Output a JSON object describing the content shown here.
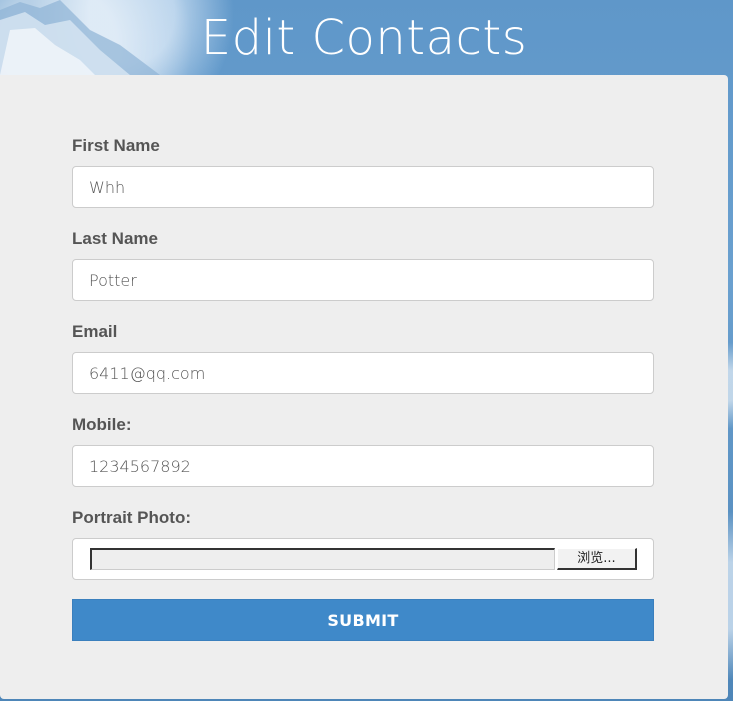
{
  "header": {
    "title": "Edit Contacts"
  },
  "form": {
    "first_name": {
      "label": "First Name",
      "value": "Whh"
    },
    "last_name": {
      "label": "Last Name",
      "value": "Potter"
    },
    "email": {
      "label": "Email",
      "value": "6411@qq.com"
    },
    "mobile": {
      "label": "Mobile:",
      "value": "1234567892"
    },
    "portrait_photo": {
      "label": "Portrait Photo:",
      "path": "",
      "browse_label": "浏览..."
    },
    "submit_label": "SUBMIT"
  },
  "colors": {
    "accent": "#3f89c9",
    "panel": "#eeeeee",
    "label_text": "#555555",
    "background": "#5f97c9"
  }
}
